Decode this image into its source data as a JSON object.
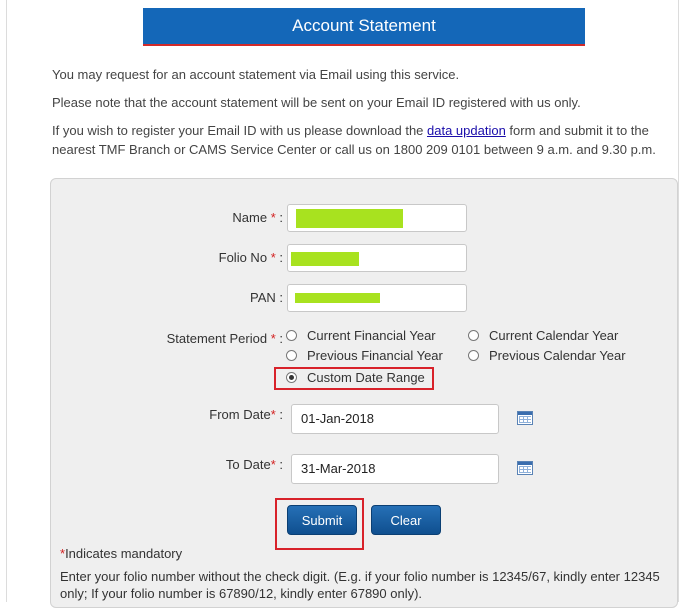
{
  "header": {
    "title": "Account Statement"
  },
  "intro": {
    "line1": "You may request for an account statement via Email using this service.",
    "line2": "Please note that the account statement will be sent on your Email ID registered with us only.",
    "line3_before": "If you wish to register your Email ID with us please download the ",
    "line3_link": "data updation",
    "line3_after": " form and submit it to the",
    "line4": "nearest TMF Branch or CAMS Service Center or call us on 1800 209 0101 between 9 a.m. and 9.30 p.m."
  },
  "form": {
    "name_label": "Name",
    "folio_label": "Folio No",
    "pan_label": "PAN",
    "period_label": "Statement Period",
    "required_mark": "*",
    "colon": ":",
    "period_options": {
      "current_financial": "Current Financial Year",
      "current_calendar": "Current Calendar Year",
      "previous_financial": "Previous Financial Year",
      "previous_calendar": "Previous Calendar Year",
      "custom": "Custom Date Range"
    },
    "selected_period": "Custom Date Range",
    "from_label": "From Date",
    "to_label": "To Date",
    "from_value": "01-Jan-2018",
    "to_value": "31-Mar-2018",
    "submit_label": "Submit",
    "clear_label": "Clear"
  },
  "notes": {
    "mandatory_mark": "*",
    "mandatory_text": "Indicates mandatory",
    "folio_hint_line1": "Enter your folio number without the check digit. (E.g. if your folio number is 12345/67, kindly enter 12345",
    "folio_hint_line2": "only; If your folio number is 67890/12, kindly enter 67890 only)."
  },
  "colors": {
    "header_bg": "#1467b8",
    "accent_red": "#d8222a",
    "redaction": "#a8e21f"
  },
  "icons": {
    "calendar": "calendar-icon"
  }
}
